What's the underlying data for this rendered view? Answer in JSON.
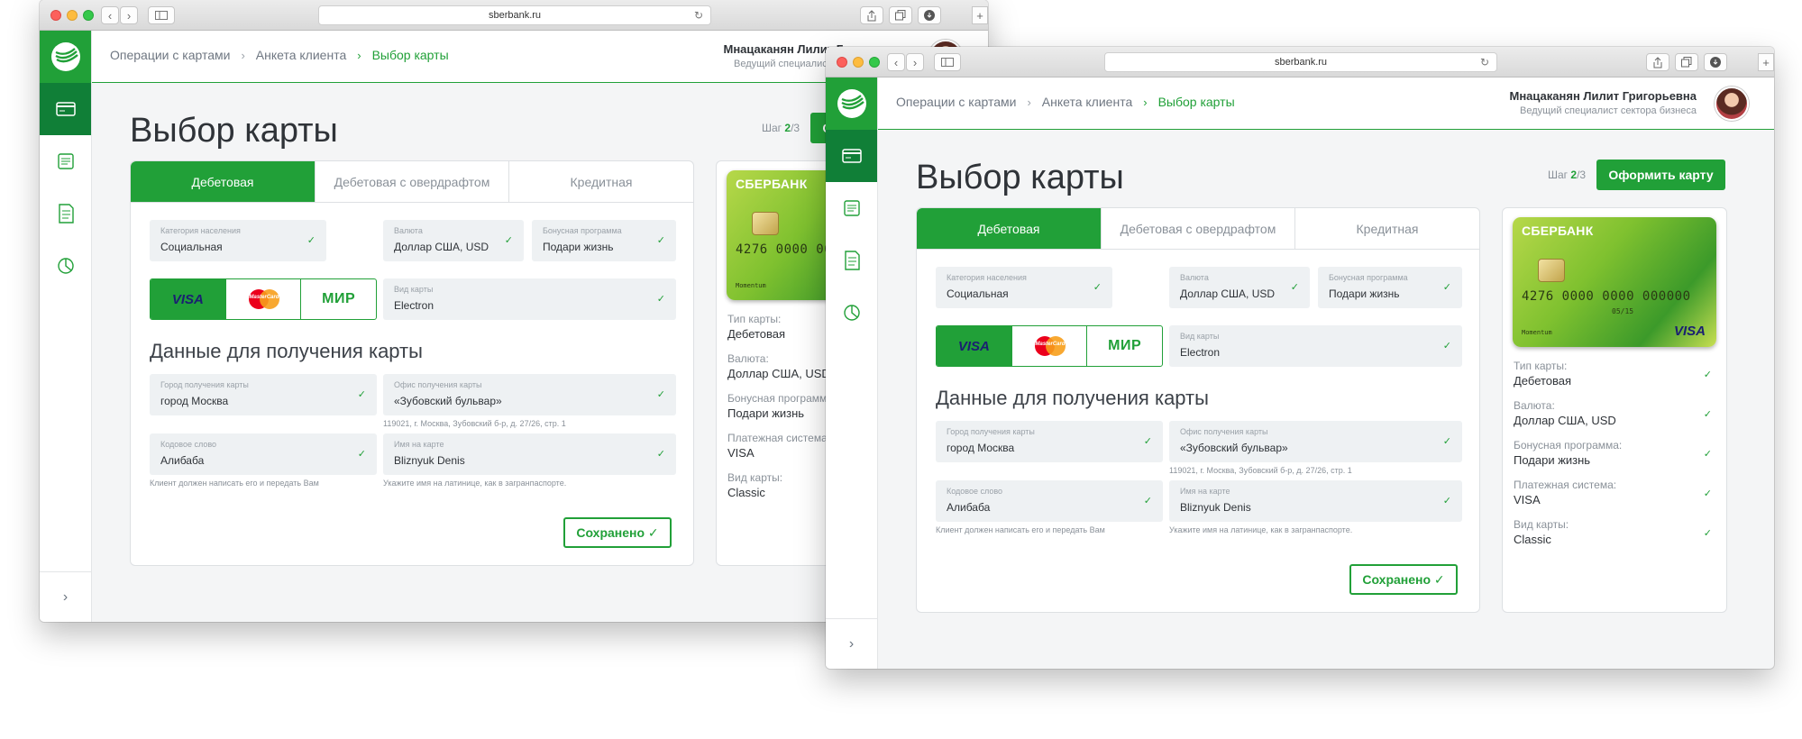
{
  "browser": {
    "url": "sberbank.ru"
  },
  "colors": {
    "brand_green": "#21a038",
    "dark_green": "#107f37",
    "text": "#2f3338",
    "muted": "#8a9199"
  },
  "sidebar": {
    "items": [
      {
        "icon": "credit-card-icon",
        "active": true
      },
      {
        "icon": "list-document-icon",
        "active": false
      },
      {
        "icon": "document-icon",
        "active": false
      },
      {
        "icon": "pie-chart-icon",
        "active": false
      }
    ],
    "expand_icon": "chevron-right-icon"
  },
  "header": {
    "breadcrumb": [
      "Операции с картами",
      "Анкета клиента",
      "Выбор карты"
    ],
    "user_name": "Мнацаканян Лилит Григорьевна",
    "user_role": "Ведущий специалист сектора бизнеса"
  },
  "page": {
    "title": "Выбор карты",
    "step_label": "Шаг",
    "step_current": "2",
    "step_total": "/3",
    "submit_label": "Оформить карту"
  },
  "tabs": [
    "Дебетовая",
    "Дебетовая с овердрафтом",
    "Кредитная"
  ],
  "form": {
    "category": {
      "label": "Категория населения",
      "value": "Социальная"
    },
    "currency": {
      "label": "Валюта",
      "value": "Доллар США, USD"
    },
    "bonus": {
      "label": "Бонусная программа",
      "value": "Подари жизнь"
    },
    "payment_systems": [
      "VISA",
      "MasterCard",
      "МИР"
    ],
    "card_kind": {
      "label": "Вид карты",
      "value": "Electron"
    },
    "section_title": "Данные для получения карты",
    "city": {
      "label": "Город получения карты",
      "value": "город Москва"
    },
    "office": {
      "label": "Офис получения карты",
      "value": "«Зубовский бульвар»",
      "hint": "119021, г. Москва, Зубовский б-р, д. 27/26, стр. 1"
    },
    "codeword": {
      "label": "Кодовое слово",
      "value": "Алибаба",
      "hint": "Клиент должен написать его и передать Вам"
    },
    "cardname": {
      "label": "Имя на карте",
      "value": "Bliznyuk Denis",
      "hint": "Укажите имя на латинице, как в загранпаспорте."
    },
    "saved_label": "Сохранено"
  },
  "card_image": {
    "bank": "СБЕРБАНК",
    "number": "4276 0000 0000 000000",
    "expiry": "05/15",
    "holder": "Momentum",
    "brand": "VISA"
  },
  "summary": [
    {
      "label": "Тип карты:",
      "value": "Дебетовая"
    },
    {
      "label": "Валюта:",
      "value": "Доллар США, USD"
    },
    {
      "label": "Бонусная программа:",
      "value": "Подари жизнь"
    },
    {
      "label": "Платежная система:",
      "value": "VISA"
    },
    {
      "label": "Вид карты:",
      "value": "Classic"
    }
  ]
}
